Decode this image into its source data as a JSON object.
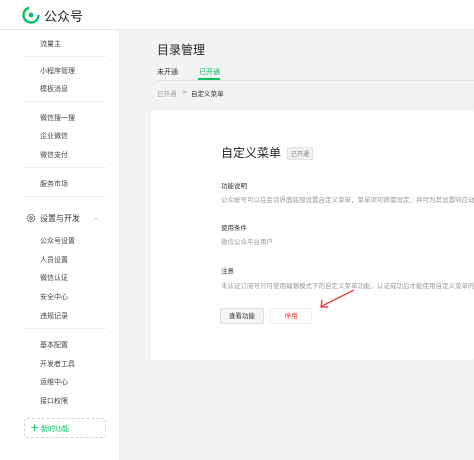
{
  "header": {
    "brand": "公众号",
    "accent": "#07c160"
  },
  "sidebar": {
    "items_top": [
      "流量主"
    ],
    "items_mini": [
      "小程序管理",
      "模板消息"
    ],
    "items_wx": [
      "微信搜一搜",
      "企业微信",
      "微信支付"
    ],
    "items_service": [
      "服务市场"
    ],
    "section": {
      "label": "设置与开发",
      "icon": "gear-icon",
      "chevron": "︿"
    },
    "items_settings": [
      "公众号设置",
      "人员设置",
      "微信认证",
      "安全中心",
      "违规记录"
    ],
    "items_dev": [
      "基本配置",
      "开发者工具",
      "运维中心",
      "接口权限"
    ],
    "new_function": {
      "plus": "+",
      "label": "新的功能"
    }
  },
  "main": {
    "title": "目录管理",
    "tabs": [
      {
        "label": "未开通"
      },
      {
        "label": "已开通"
      }
    ],
    "breadcrumb": {
      "first": "已开通",
      "sep": ">",
      "current": "自定义菜单"
    },
    "card": {
      "title": "自定义菜单",
      "badge": "已开通",
      "sections": [
        {
          "head": "功能说明",
          "text": "公众帐号可以在会话界面底部设置自定义菜单，菜单项可按需设定，并可为其设置响应动作"
        },
        {
          "head": "使用条件",
          "text": "微信公众平台用户"
        },
        {
          "head": "注意",
          "text": "未认证订阅号只可使用编辑模式下的自定义菜单功能，认证成功后才能使用自定义菜单的..."
        }
      ],
      "buttons": {
        "view": "查看功能",
        "disable": "停用"
      }
    }
  },
  "annotation": {
    "arrow_color": "#e64340"
  }
}
